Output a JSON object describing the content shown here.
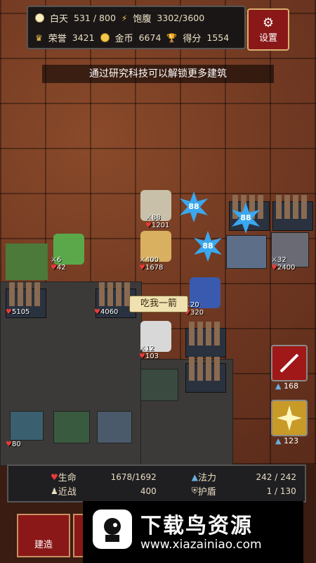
{
  "hud": {
    "day_label": "白天",
    "day_value": "531 / 800",
    "hunger_label": "饱腹",
    "hunger_value": "3302/3600",
    "honor_label": "荣誉",
    "honor_value": "3421",
    "gold_label": "金币",
    "gold_value": "6674",
    "score_label": "得分",
    "score_value": "1554"
  },
  "settings_label": "设置",
  "tip": "通过研究科技可以解锁更多建筑",
  "units": [
    {
      "atk": "88",
      "hp": "1201"
    },
    {
      "atk": "400",
      "hp": "1678"
    },
    {
      "atk": "6",
      "hp": "42"
    },
    {
      "atk": "12",
      "hp": "103"
    },
    {
      "atk": "20",
      "hp": "320"
    },
    {
      "atk": "32",
      "hp": "2400"
    }
  ],
  "tower_hp": [
    "5105",
    "4060",
    "80"
  ],
  "hits": [
    "88",
    "88",
    "88"
  ],
  "speech": "吃我一箭",
  "skills": [
    {
      "name": "sword-skill",
      "count": "168"
    },
    {
      "name": "light-skill",
      "count": "123"
    }
  ],
  "panel": {
    "life_label": "生命",
    "life_value": "1678/1692",
    "mana_label": "法力",
    "mana_value": "242 / 242",
    "melee_label": "近战",
    "melee_value": "400",
    "shield_label": "护盾",
    "shield_value": "1  / 130"
  },
  "build_label": "建造",
  "watermark": {
    "title": "下载鸟资源",
    "url": "www.xiazainiao.com"
  },
  "colors": {
    "accent_red": "#8a1818",
    "hit_blue": "#3aa8f0",
    "heart": "#e83a3a"
  }
}
